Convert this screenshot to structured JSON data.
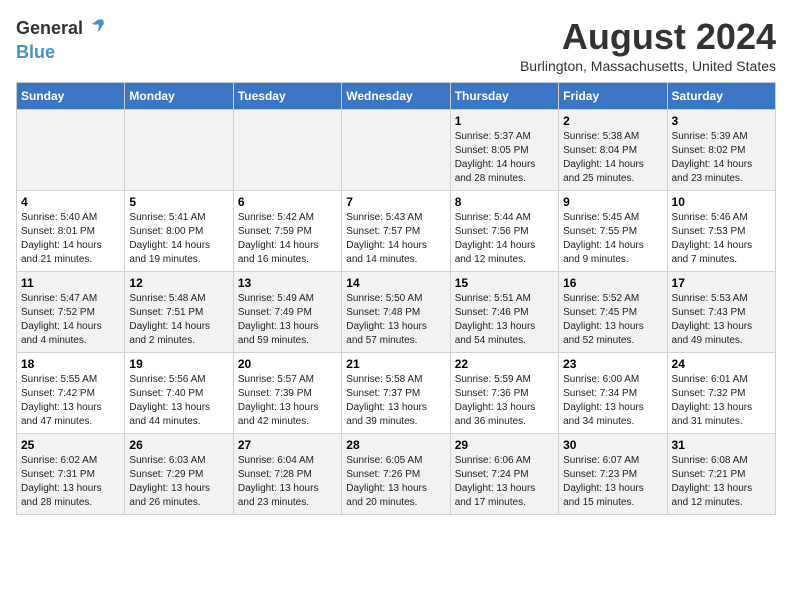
{
  "logo": {
    "general": "General",
    "blue": "Blue"
  },
  "title": "August 2024",
  "location": "Burlington, Massachusetts, United States",
  "days_of_week": [
    "Sunday",
    "Monday",
    "Tuesday",
    "Wednesday",
    "Thursday",
    "Friday",
    "Saturday"
  ],
  "weeks": [
    [
      {
        "day": "",
        "info": ""
      },
      {
        "day": "",
        "info": ""
      },
      {
        "day": "",
        "info": ""
      },
      {
        "day": "",
        "info": ""
      },
      {
        "day": "1",
        "sunrise": "5:37 AM",
        "sunset": "8:05 PM",
        "daylight": "14 hours and 28 minutes."
      },
      {
        "day": "2",
        "sunrise": "5:38 AM",
        "sunset": "8:04 PM",
        "daylight": "14 hours and 25 minutes."
      },
      {
        "day": "3",
        "sunrise": "5:39 AM",
        "sunset": "8:02 PM",
        "daylight": "14 hours and 23 minutes."
      }
    ],
    [
      {
        "day": "4",
        "sunrise": "5:40 AM",
        "sunset": "8:01 PM",
        "daylight": "14 hours and 21 minutes."
      },
      {
        "day": "5",
        "sunrise": "5:41 AM",
        "sunset": "8:00 PM",
        "daylight": "14 hours and 19 minutes."
      },
      {
        "day": "6",
        "sunrise": "5:42 AM",
        "sunset": "7:59 PM",
        "daylight": "14 hours and 16 minutes."
      },
      {
        "day": "7",
        "sunrise": "5:43 AM",
        "sunset": "7:57 PM",
        "daylight": "14 hours and 14 minutes."
      },
      {
        "day": "8",
        "sunrise": "5:44 AM",
        "sunset": "7:56 PM",
        "daylight": "14 hours and 12 minutes."
      },
      {
        "day": "9",
        "sunrise": "5:45 AM",
        "sunset": "7:55 PM",
        "daylight": "14 hours and 9 minutes."
      },
      {
        "day": "10",
        "sunrise": "5:46 AM",
        "sunset": "7:53 PM",
        "daylight": "14 hours and 7 minutes."
      }
    ],
    [
      {
        "day": "11",
        "sunrise": "5:47 AM",
        "sunset": "7:52 PM",
        "daylight": "14 hours and 4 minutes."
      },
      {
        "day": "12",
        "sunrise": "5:48 AM",
        "sunset": "7:51 PM",
        "daylight": "14 hours and 2 minutes."
      },
      {
        "day": "13",
        "sunrise": "5:49 AM",
        "sunset": "7:49 PM",
        "daylight": "13 hours and 59 minutes."
      },
      {
        "day": "14",
        "sunrise": "5:50 AM",
        "sunset": "7:48 PM",
        "daylight": "13 hours and 57 minutes."
      },
      {
        "day": "15",
        "sunrise": "5:51 AM",
        "sunset": "7:46 PM",
        "daylight": "13 hours and 54 minutes."
      },
      {
        "day": "16",
        "sunrise": "5:52 AM",
        "sunset": "7:45 PM",
        "daylight": "13 hours and 52 minutes."
      },
      {
        "day": "17",
        "sunrise": "5:53 AM",
        "sunset": "7:43 PM",
        "daylight": "13 hours and 49 minutes."
      }
    ],
    [
      {
        "day": "18",
        "sunrise": "5:55 AM",
        "sunset": "7:42 PM",
        "daylight": "13 hours and 47 minutes."
      },
      {
        "day": "19",
        "sunrise": "5:56 AM",
        "sunset": "7:40 PM",
        "daylight": "13 hours and 44 minutes."
      },
      {
        "day": "20",
        "sunrise": "5:57 AM",
        "sunset": "7:39 PM",
        "daylight": "13 hours and 42 minutes."
      },
      {
        "day": "21",
        "sunrise": "5:58 AM",
        "sunset": "7:37 PM",
        "daylight": "13 hours and 39 minutes."
      },
      {
        "day": "22",
        "sunrise": "5:59 AM",
        "sunset": "7:36 PM",
        "daylight": "13 hours and 36 minutes."
      },
      {
        "day": "23",
        "sunrise": "6:00 AM",
        "sunset": "7:34 PM",
        "daylight": "13 hours and 34 minutes."
      },
      {
        "day": "24",
        "sunrise": "6:01 AM",
        "sunset": "7:32 PM",
        "daylight": "13 hours and 31 minutes."
      }
    ],
    [
      {
        "day": "25",
        "sunrise": "6:02 AM",
        "sunset": "7:31 PM",
        "daylight": "13 hours and 28 minutes."
      },
      {
        "day": "26",
        "sunrise": "6:03 AM",
        "sunset": "7:29 PM",
        "daylight": "13 hours and 26 minutes."
      },
      {
        "day": "27",
        "sunrise": "6:04 AM",
        "sunset": "7:28 PM",
        "daylight": "13 hours and 23 minutes."
      },
      {
        "day": "28",
        "sunrise": "6:05 AM",
        "sunset": "7:26 PM",
        "daylight": "13 hours and 20 minutes."
      },
      {
        "day": "29",
        "sunrise": "6:06 AM",
        "sunset": "7:24 PM",
        "daylight": "13 hours and 17 minutes."
      },
      {
        "day": "30",
        "sunrise": "6:07 AM",
        "sunset": "7:23 PM",
        "daylight": "13 hours and 15 minutes."
      },
      {
        "day": "31",
        "sunrise": "6:08 AM",
        "sunset": "7:21 PM",
        "daylight": "13 hours and 12 minutes."
      }
    ]
  ],
  "labels": {
    "sunrise": "Sunrise:",
    "sunset": "Sunset:",
    "daylight": "Daylight:"
  }
}
